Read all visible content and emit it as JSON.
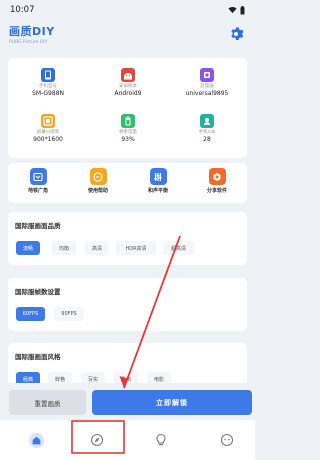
{
  "status_bar": {
    "time": "10:07"
  },
  "header": {
    "title": "画质DIY",
    "subtitle": "PUBG Picture DIY"
  },
  "device_info": [
    {
      "label": "手机型号",
      "value": "SM-G988N",
      "icon": "phone-icon",
      "color": "#2f6fe4"
    },
    {
      "label": "安卓版本",
      "value": "Android9",
      "icon": "android-icon",
      "color": "#e0483e"
    },
    {
      "label": "处理器",
      "value": "universal9895",
      "icon": "chip-icon",
      "color": "#8a56e8"
    },
    {
      "label": "屏幕分辨率",
      "value": "900*1600",
      "icon": "screen-icon",
      "color": "#f5a623"
    },
    {
      "label": "剩余电量",
      "value": "93%",
      "icon": "battery-icon",
      "color": "#2fbf6a"
    },
    {
      "label": "手机sdk",
      "value": "28",
      "icon": "sdk-icon",
      "color": "#23b29c"
    }
  ],
  "quick_actions": [
    {
      "label": "地铁广角",
      "icon": "widescreen-icon",
      "color": "#3d7ae8"
    },
    {
      "label": "使用帮助",
      "icon": "help-icon",
      "color": "#f5a623"
    },
    {
      "label": "和声平衡",
      "icon": "equalizer-icon",
      "color": "#3d7ae8"
    },
    {
      "label": "分享软件",
      "icon": "share-icon",
      "color": "#f06a2a"
    }
  ],
  "sections": {
    "quality": {
      "title": "国际服画面品质",
      "options": [
        "流畅",
        "均衡",
        "高清",
        "HDR高清",
        "超高清"
      ],
      "selected": "流畅"
    },
    "fps": {
      "title": "国际服帧数设置",
      "options": [
        "60FPS",
        "90FPS"
      ],
      "selected": "60FPS"
    },
    "style": {
      "title": "国际服画面风格",
      "options": [
        "经典",
        "鲜艳",
        "写实",
        "柔和",
        "电影"
      ],
      "selected": "经典"
    }
  },
  "actions": {
    "reset_label": "重置画质",
    "apply_label": "立即解锁"
  },
  "colors": {
    "accent": "#3d7ae8",
    "annotation_red": "#e53935"
  }
}
